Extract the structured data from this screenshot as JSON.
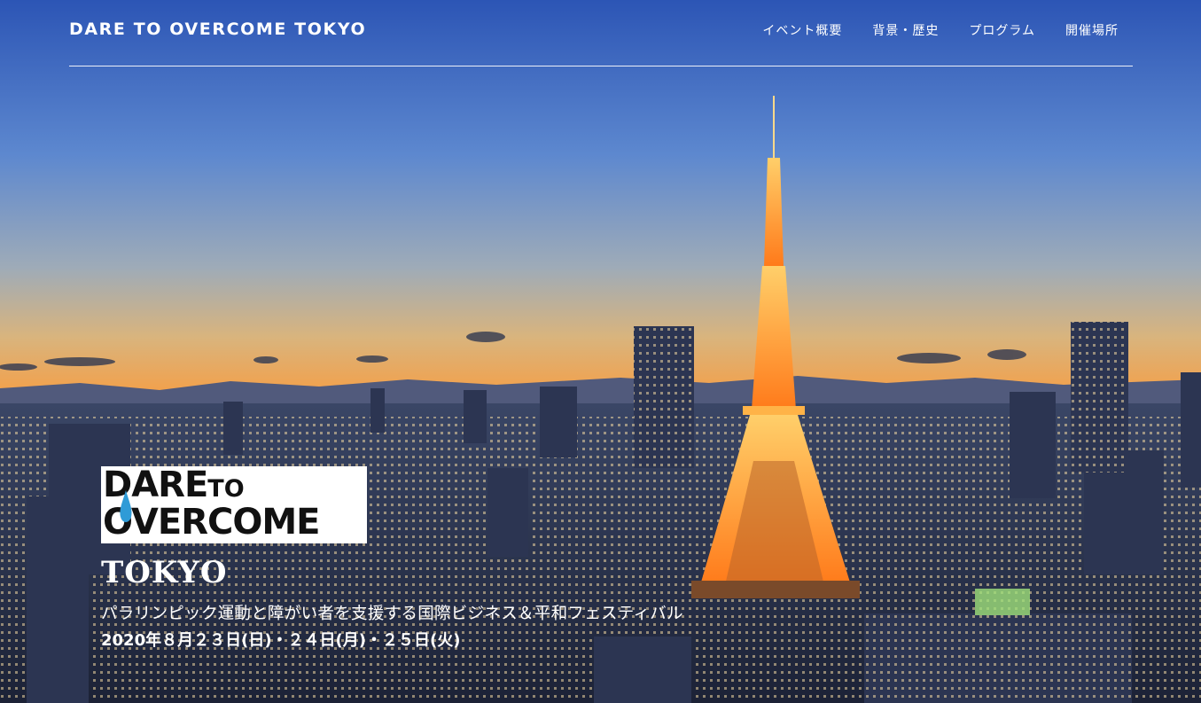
{
  "header": {
    "brand": "DARE TO OVERCOME TOKYO",
    "nav": [
      {
        "label": "イベント概要"
      },
      {
        "label": "背景・歴史"
      },
      {
        "label": "プログラム"
      },
      {
        "label": "開催場所"
      }
    ]
  },
  "hero": {
    "logo": {
      "line1": "DARE",
      "line1_small": "TO",
      "line2": "OVERCOME"
    },
    "city": "TOKYO",
    "tagline": "パラリンピック運動と障がい者を支援する国際ビジネス＆平和フェスティバル",
    "dates": "2020年８月２３日(日)・２４日(月)・２５日(火)"
  },
  "colors": {
    "sky_top": "#2e58b8",
    "sky_mid": "#9aa7b8",
    "sky_glow": "#f0a24a",
    "tower": "#ff9a2e",
    "logo_drop": "#2f9bd7"
  },
  "icons": {
    "logo_drop": "water-drop-icon"
  }
}
